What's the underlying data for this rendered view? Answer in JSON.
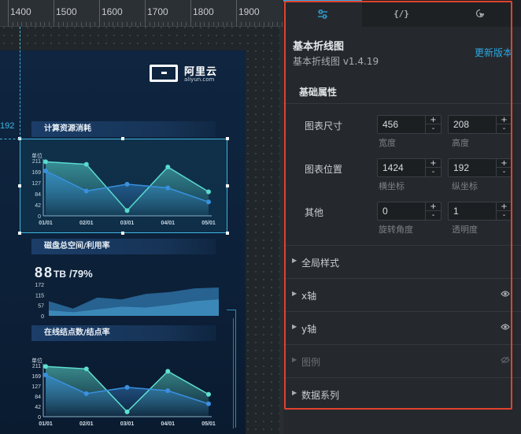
{
  "ruler": {
    "labels": [
      "1400",
      "1500",
      "1600",
      "1700",
      "1800",
      "1900"
    ]
  },
  "guide": {
    "y_label": "192"
  },
  "dashboard": {
    "logo": {
      "cn": "阿里云",
      "en": "aliyun.com"
    },
    "section1_title": "计算资源消耗",
    "section2_title": "磁盘总空间/利用率",
    "section3_title": "在线结点数/结点率",
    "storage": {
      "value": "88",
      "unit": "TB",
      "percent": "/79%"
    }
  },
  "chart_data": [
    {
      "type": "line",
      "title": "计算资源消耗",
      "ylabel": "单位",
      "categories": [
        "01/01",
        "02/01",
        "03/01",
        "04/01",
        "05/01"
      ],
      "y_ticks": [
        "0",
        "42",
        "84",
        "127",
        "169",
        "211"
      ],
      "ylim": [
        0,
        211
      ],
      "series": [
        {
          "values": [
            207,
            197,
            20,
            187,
            92
          ],
          "color": "#5ee0d0",
          "area": true
        },
        {
          "values": [
            172,
            95,
            121,
            107,
            53
          ],
          "color": "#3a8fe0",
          "area": true
        }
      ]
    },
    {
      "type": "area",
      "title": "磁盘总空间/利用率",
      "y_ticks": [
        "0",
        "57",
        "115",
        "172"
      ],
      "ylim": [
        0,
        172
      ],
      "series": [
        {
          "values": [
            80,
            40,
            100,
            90,
            120,
            130,
            150,
            155
          ],
          "color": "#2d6fa0"
        },
        {
          "values": [
            30,
            20,
            35,
            50,
            45,
            60,
            80,
            90
          ],
          "color": "#3f8fc0"
        }
      ]
    },
    {
      "type": "line",
      "title": "在线结点数/结点率",
      "ylabel": "单位",
      "categories": [
        "01/01",
        "02/01",
        "03/01",
        "04/01",
        "05/01"
      ],
      "y_ticks": [
        "0",
        "42",
        "84",
        "127",
        "169",
        "211"
      ],
      "ylim": [
        0,
        211
      ],
      "series": [
        {
          "values": [
            207,
            197,
            20,
            187,
            92
          ],
          "color": "#5ee0d0",
          "area": true
        },
        {
          "values": [
            172,
            95,
            121,
            107,
            53
          ],
          "color": "#3a8fe0",
          "area": true
        }
      ]
    }
  ],
  "panel": {
    "tabs": [
      {
        "name": "style-tab",
        "icon": "sliders-icon",
        "active": true
      },
      {
        "name": "data-tab",
        "label": "{/}",
        "active": false
      },
      {
        "name": "interaction-tab",
        "icon": "cursor-click-icon",
        "active": false
      }
    ],
    "component_title": "基本折线图",
    "component_version": "基本折线图 v1.4.19",
    "update_link": "更新版本",
    "basic_props": "基础属性",
    "rows": {
      "size": {
        "label": "图表尺寸",
        "a": {
          "value": "456",
          "sub": "宽度"
        },
        "b": {
          "value": "208",
          "sub": "高度"
        }
      },
      "position": {
        "label": "图表位置",
        "a": {
          "value": "1424",
          "sub": "横坐标"
        },
        "b": {
          "value": "192",
          "sub": "纵坐标"
        }
      },
      "other": {
        "label": "其他",
        "a": {
          "value": "0",
          "sub": "旋转角度"
        },
        "b": {
          "value": "1",
          "sub": "透明度"
        }
      }
    },
    "stepper": {
      "up": "+",
      "down": "-"
    },
    "sections": [
      {
        "label": "全局样式",
        "eye": false,
        "disabled": false
      },
      {
        "label": "x轴",
        "eye": "visible",
        "disabled": false
      },
      {
        "label": "y轴",
        "eye": "visible",
        "disabled": false
      },
      {
        "label": "图例",
        "eye": "hidden",
        "disabled": true
      },
      {
        "label": "数据系列",
        "eye": false,
        "disabled": false
      }
    ],
    "highlight_color": "#e2412f",
    "accent_color": "#2ea7e0"
  }
}
